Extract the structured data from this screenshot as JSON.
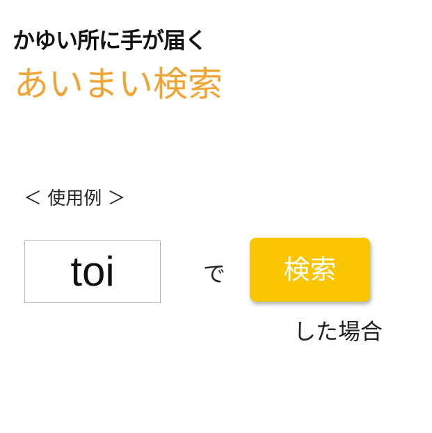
{
  "header": {
    "tagline": "かゆい所に手が届く",
    "headline": "あいまい検索"
  },
  "example": {
    "label": "＜ 使用例 ＞",
    "search_value": "toi",
    "particle": "で",
    "search_button_label": "検索",
    "result_caption": "した場合"
  },
  "colors": {
    "headline": "#f0a436",
    "button_background": "#f9c400",
    "button_text": "#ffffff"
  }
}
